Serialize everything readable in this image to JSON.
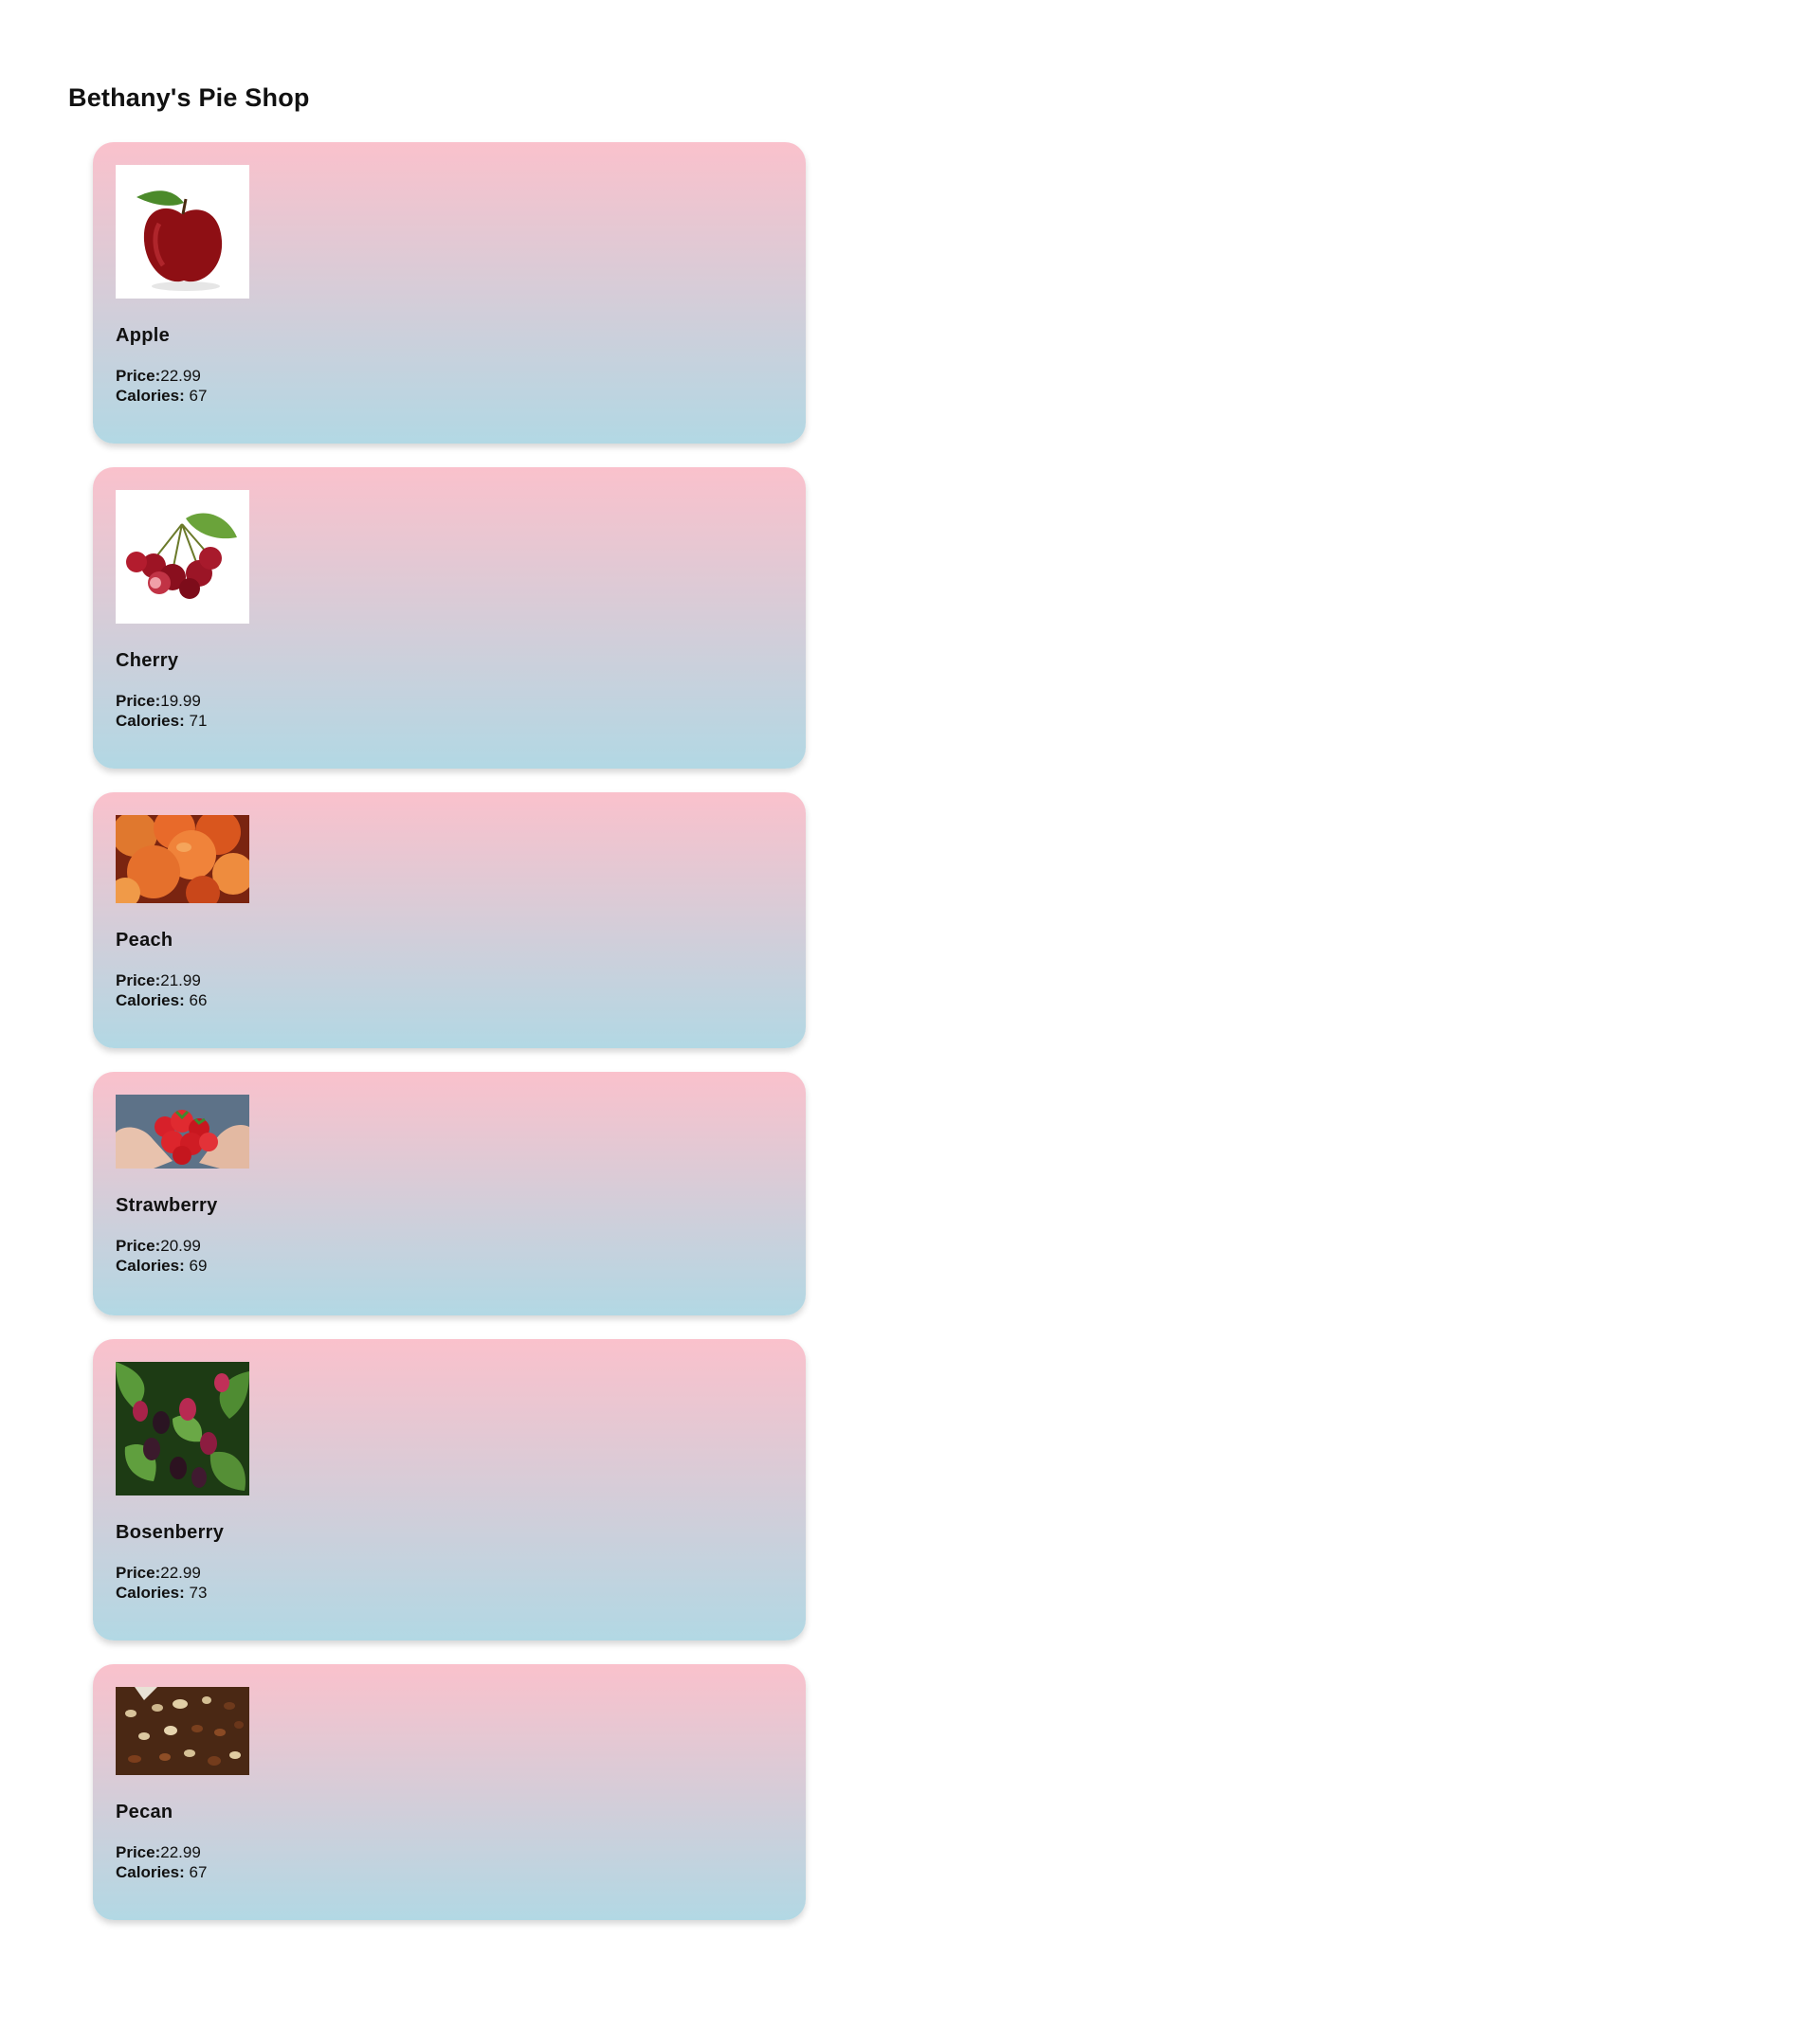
{
  "shop": {
    "title": "Bethany's Pie Shop"
  },
  "labels": {
    "price": "Price:",
    "calories": "Calories:"
  },
  "pies": [
    {
      "name": "Apple",
      "price": "22.99",
      "calories": "67",
      "image_icon": "apple-image"
    },
    {
      "name": "Cherry",
      "price": "19.99",
      "calories": "71",
      "image_icon": "cherry-image"
    },
    {
      "name": "Peach",
      "price": "21.99",
      "calories": "66",
      "image_icon": "peach-image"
    },
    {
      "name": "Strawberry",
      "price": "20.99",
      "calories": "69",
      "image_icon": "strawberry-image"
    },
    {
      "name": "Bosenberry",
      "price": "22.99",
      "calories": "73",
      "image_icon": "bosenberry-image"
    },
    {
      "name": "Pecan",
      "price": "22.99",
      "calories": "67",
      "image_icon": "pecan-image"
    }
  ],
  "colors": {
    "card_gradient_top": "#fac1cc",
    "card_gradient_bottom": "#b2d8e4"
  }
}
